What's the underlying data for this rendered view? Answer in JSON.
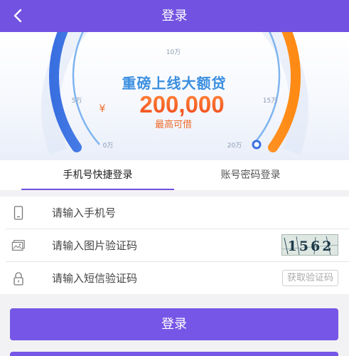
{
  "header": {
    "title": "登录",
    "back_icon": "chevron-left-icon",
    "bg_color": "#7252e0"
  },
  "banner": {
    "headline": "重磅上线大额贷",
    "currency": "¥",
    "amount": "200,000",
    "caption": "最高可借",
    "scale_labels": [
      "0万",
      "5万",
      "10万",
      "15万",
      "20万"
    ],
    "gauge_colors": [
      "#3a6fe0",
      "#ff8a14"
    ]
  },
  "tabs": [
    {
      "label": "手机号快捷登录",
      "active": true
    },
    {
      "label": "账号密码登录",
      "active": false
    }
  ],
  "form": {
    "phone": {
      "placeholder": "请输入手机号",
      "icon": "phone-icon"
    },
    "image_code": {
      "placeholder": "请输入图片验证码",
      "icon": "image-icon",
      "captcha_text": "1562"
    },
    "sms_code": {
      "placeholder": "请输入短信验证码",
      "icon": "lock-icon",
      "button_label": "获取验证码"
    }
  },
  "submit_label": "登录",
  "accent_color": "#7656e6"
}
